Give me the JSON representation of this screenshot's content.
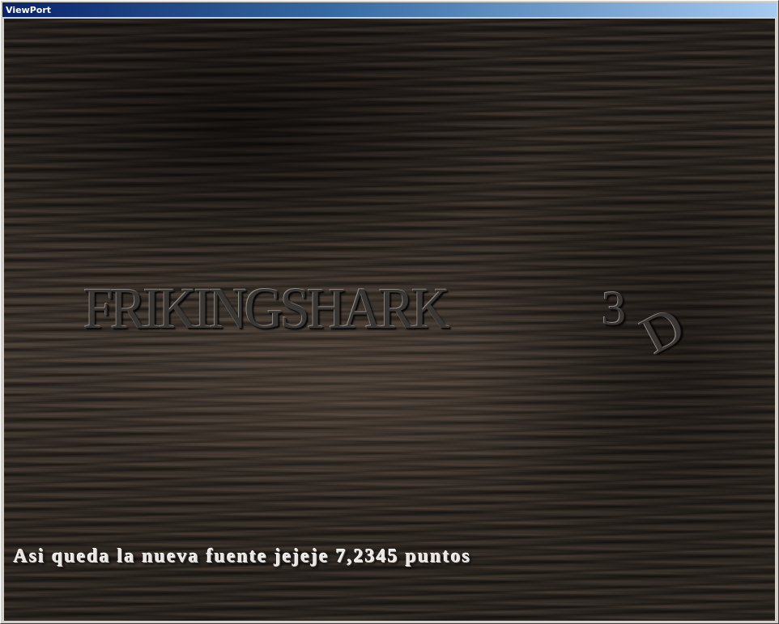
{
  "window": {
    "title": "ViewPort"
  },
  "logo": {
    "main": "FRIKINGSHARK",
    "three": "3",
    "d": "D"
  },
  "status": {
    "text": "Asi queda la nueva fuente jejeje 7,2345 puntos"
  },
  "colors": {
    "titlebar_start": "#0a246a",
    "titlebar_end": "#a6caf0",
    "background_wood": "#3a322b",
    "logo_metal": "#3a3633",
    "status_text": "#e8e4df"
  }
}
